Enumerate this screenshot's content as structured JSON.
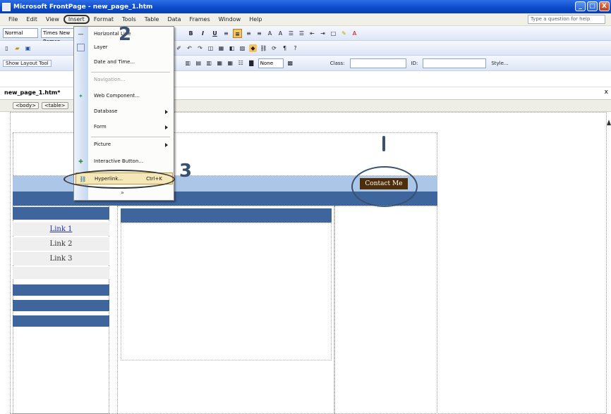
{
  "window": {
    "title": "Microsoft FrontPage - new_page_1.htm",
    "controls": [
      "_",
      "□",
      "X"
    ]
  },
  "menubar": {
    "items": [
      "File",
      "Edit",
      "View",
      "Insert",
      "Format",
      "Tools",
      "Table",
      "Data",
      "Frames",
      "Window",
      "Help"
    ],
    "active_item": "Insert",
    "ask_placeholder": "Type a question for help"
  },
  "toolbar_format": {
    "style": "Normal",
    "font": "Times New Roman",
    "buttons": [
      "B",
      "I",
      "U"
    ]
  },
  "toolbar_tables": {
    "show_layout_label": "Show Layout Tool",
    "none_label": "None",
    "class_label": "Class:",
    "id_label": "ID:",
    "style_label": "Style..."
  },
  "doc": {
    "tab": "new_page_1.htm*",
    "close": "x",
    "tags": [
      "<body>",
      "<table>"
    ]
  },
  "insert_menu": {
    "items": [
      {
        "label": "Horizontal Line",
        "disabled": false,
        "submenu": false
      },
      {
        "label": "Layer",
        "disabled": false,
        "submenu": false
      },
      {
        "label": "Date and Time...",
        "disabled": false,
        "submenu": false
      },
      {
        "label": "Navigation...",
        "disabled": true,
        "submenu": false
      },
      {
        "label": "Web Component...",
        "disabled": false,
        "submenu": false
      },
      {
        "label": "Database",
        "disabled": false,
        "submenu": true
      },
      {
        "label": "Form",
        "disabled": false,
        "submenu": true
      },
      {
        "label": "Picture",
        "disabled": false,
        "submenu": true
      },
      {
        "label": "Interactive Button...",
        "disabled": false,
        "submenu": false
      },
      {
        "label": "Hyperlink...",
        "shortcut": "Ctrl+K",
        "disabled": false,
        "submenu": false,
        "highlighted": true
      }
    ],
    "expand": "»"
  },
  "page": {
    "contact_button": "Contact Me",
    "nav_links": [
      "Link 1",
      "Link 2",
      "Link 3"
    ]
  },
  "annotations": {
    "step1": "1",
    "step2": "2",
    "step3": "3"
  },
  "colors": {
    "banner_light": "#abc6e6",
    "banner_dark": "#3e659c",
    "contact_bg": "#4e2e0a",
    "annotation": "#385170"
  }
}
